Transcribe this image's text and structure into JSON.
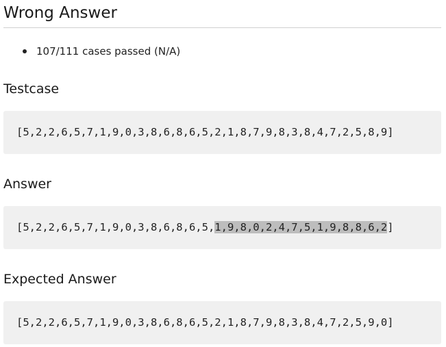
{
  "result": {
    "title": "Wrong Answer",
    "status": "107/111 cases passed (N/A)"
  },
  "testcase": {
    "heading": "Testcase",
    "value": "[5,2,2,6,5,7,1,9,0,3,8,6,8,6,5,2,1,8,7,9,8,3,8,4,7,2,5,8,9]"
  },
  "answer": {
    "heading": "Answer",
    "prefix": "[5,2,2,6,5,7,1,9,0,3,8,6,8,6,5,",
    "highlighted": "1,9,8,0,2,4,7,5,1,9,8,8,6,2",
    "suffix": "]"
  },
  "expected": {
    "heading": "Expected Answer",
    "value": "[5,2,2,6,5,7,1,9,0,3,8,6,8,6,5,2,1,8,7,9,8,3,8,4,7,2,5,9,0]"
  }
}
